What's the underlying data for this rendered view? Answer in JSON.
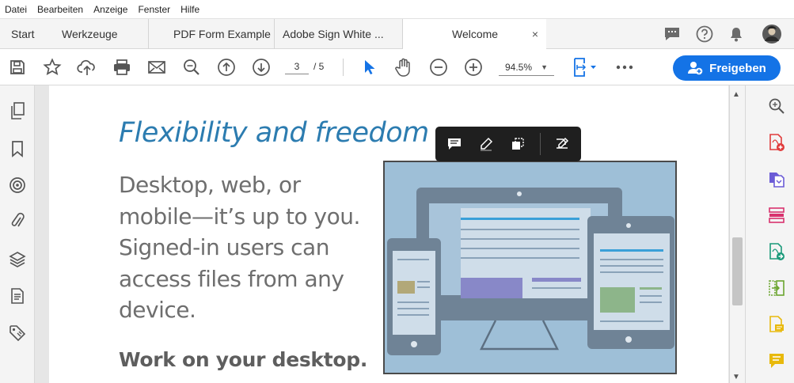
{
  "menubar": {
    "items": [
      "Datei",
      "Bearbeiten",
      "Anzeige",
      "Fenster",
      "Hilfe"
    ]
  },
  "tabs": {
    "start": "Start",
    "tools": "Werkzeuge",
    "doc1": "PDF Form Example",
    "doc2": "Adobe Sign White ...",
    "active": "Welcome",
    "close_glyph": "×"
  },
  "toolbar": {
    "page_current": "3",
    "page_total": "/ 5",
    "zoom": "94.5%",
    "share_label": "Freigeben"
  },
  "document": {
    "heading": "Flexibility and freedom",
    "body_lines": [
      "Desktop, web, or",
      "mobile—it’s up to you.",
      "Signed-in users can",
      "access files from any",
      "device."
    ],
    "subheading": "Work on your desktop."
  },
  "colors": {
    "accent": "#1473e6",
    "heading": "#2c7cb0",
    "illustration_bg": "#9ebfd7"
  }
}
